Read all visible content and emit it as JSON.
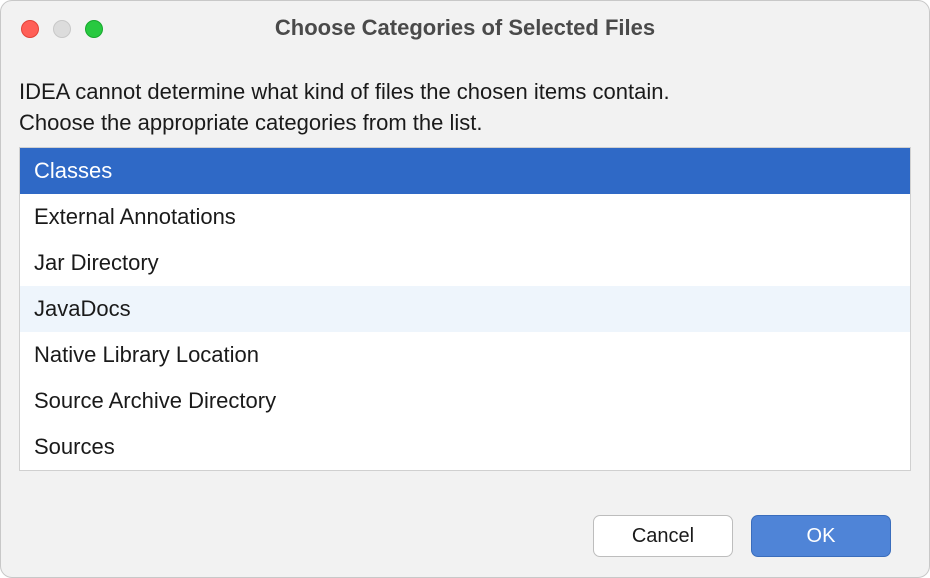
{
  "window": {
    "title": "Choose Categories of Selected Files"
  },
  "description": {
    "line1": "IDEA cannot determine what kind of files the chosen items contain.",
    "line2": "Choose the appropriate categories from the list."
  },
  "categories": {
    "items": [
      {
        "label": "Classes",
        "selected": true,
        "hovered": false
      },
      {
        "label": "External Annotations",
        "selected": false,
        "hovered": false
      },
      {
        "label": "Jar Directory",
        "selected": false,
        "hovered": false
      },
      {
        "label": "JavaDocs",
        "selected": false,
        "hovered": true
      },
      {
        "label": "Native Library Location",
        "selected": false,
        "hovered": false
      },
      {
        "label": "Source Archive Directory",
        "selected": false,
        "hovered": false
      },
      {
        "label": "Sources",
        "selected": false,
        "hovered": false
      }
    ]
  },
  "buttons": {
    "cancel": "Cancel",
    "ok": "OK"
  }
}
